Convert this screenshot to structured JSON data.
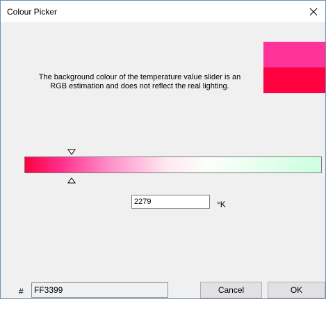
{
  "window": {
    "title": "Colour Picker"
  },
  "icons": {
    "close": "close-icon",
    "slider_thumb_top": "triangle-down-icon",
    "slider_thumb_bottom": "triangle-up-icon"
  },
  "swatches": {
    "current_color": "#ff3399",
    "new_color": "#ff0040"
  },
  "info_text": "The background colour of the temperature value slider is an RGB estimation and does not reflect the real lighting.",
  "temperature": {
    "value": "2279",
    "unit": "°K",
    "slider_level_fraction": 0.16,
    "gradient_colors": [
      "#ff0040",
      "#ff2f8c",
      "#ff8cc9",
      "#ffe9f1",
      "#fbfffa",
      "#ccffe1"
    ]
  },
  "hex": {
    "prefix": "#",
    "value": "FF3399"
  },
  "buttons": {
    "cancel": "Cancel",
    "ok": "OK"
  }
}
